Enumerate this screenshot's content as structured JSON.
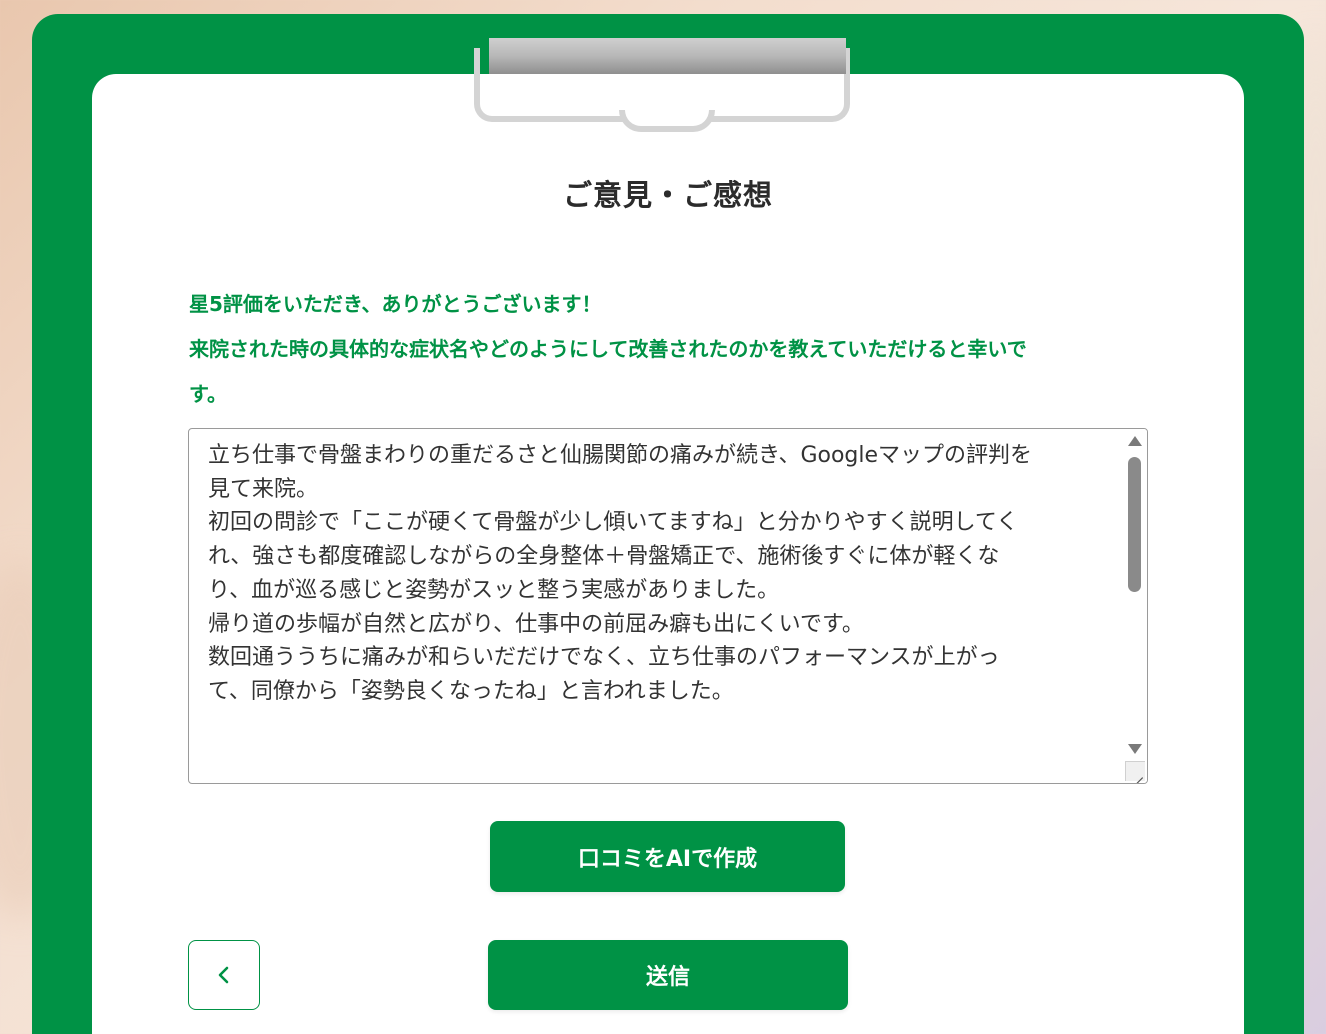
{
  "form": {
    "title": "ご意見・ご感想",
    "message_lines": [
      "星5評価をいただき、ありがとうございます！",
      "来院された時の具体的な症状名やどのようにして改善されたのかを教えていただけると幸いで",
      "す。"
    ],
    "review_text": "立ち仕事で骨盤まわりの重だるさと仙腸関節の痛みが続き、Googleマップの評判を\n見て来院。\n初回の問診で「ここが硬くて骨盤が少し傾いてますね」と分かりやすく説明してく\nれ、強さも都度確認しながらの全身整体＋骨盤矯正で、施術後すぐに体が軽くな\nり、血が巡る感じと姿勢がスッと整う実感がありました。\n帰り道の歩幅が自然と広がり、仕事中の前屈み癖も出にくいです。\n数回通ううちに痛みが和らいだだけでなく、立ち仕事のパフォーマンスが上がっ\nて、同僚から「姿勢良くなったね」と言われました。"
  },
  "buttons": {
    "ai_generate": "口コミをAIで作成",
    "submit": "送信",
    "back_icon": "chevron-left-icon"
  },
  "colors": {
    "brand_green": "#009245",
    "title_text": "#2b2b2b",
    "body_text": "#333333",
    "paper": "#ffffff"
  }
}
